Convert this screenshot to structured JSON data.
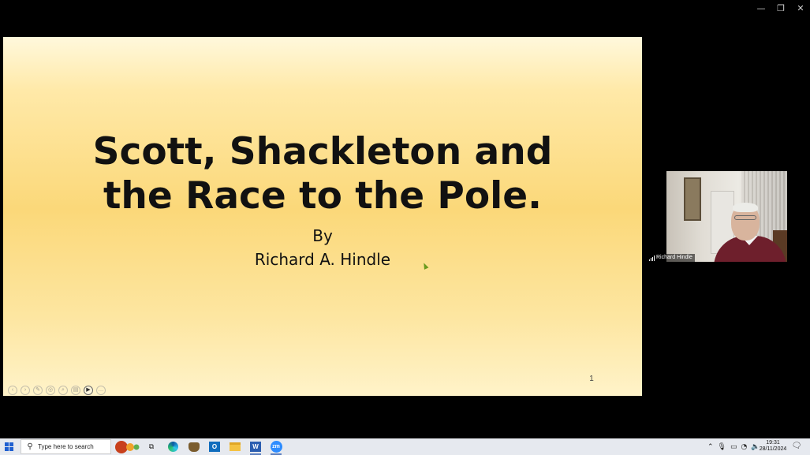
{
  "window": {
    "minimize_glyph": "—",
    "restore_glyph": "❐",
    "close_glyph": "✕"
  },
  "slide": {
    "title_line1": "Scott, Shackleton and",
    "title_line2": "the Race to the Pole.",
    "by": "By",
    "author": "Richard A. Hindle",
    "page_number": "1",
    "toolbar_icons": [
      "back-icon",
      "forward-icon",
      "pen-icon",
      "pointer-icon",
      "zoom-icon",
      "slides-icon",
      "camera-icon",
      "more-icon"
    ]
  },
  "video": {
    "participant_name": "Richard Hindle"
  },
  "taskbar": {
    "search_placeholder": "Type here to search",
    "apps": [
      "task-view",
      "edge",
      "game",
      "outlook",
      "file-explorer",
      "word",
      "zoom"
    ],
    "outlook_letter": "O",
    "word_letter": "W",
    "zoom_letters": "zm",
    "tray_icons": [
      "chevron-up-icon",
      "microphone-icon",
      "battery-icon",
      "wifi-icon",
      "volume-icon"
    ],
    "time": "19:31",
    "date": "28/11/2024"
  },
  "colors": {
    "slide_gold": "#fbd879",
    "taskbar_bg": "#e6e9ef",
    "zoom_blue": "#2d8cff"
  }
}
